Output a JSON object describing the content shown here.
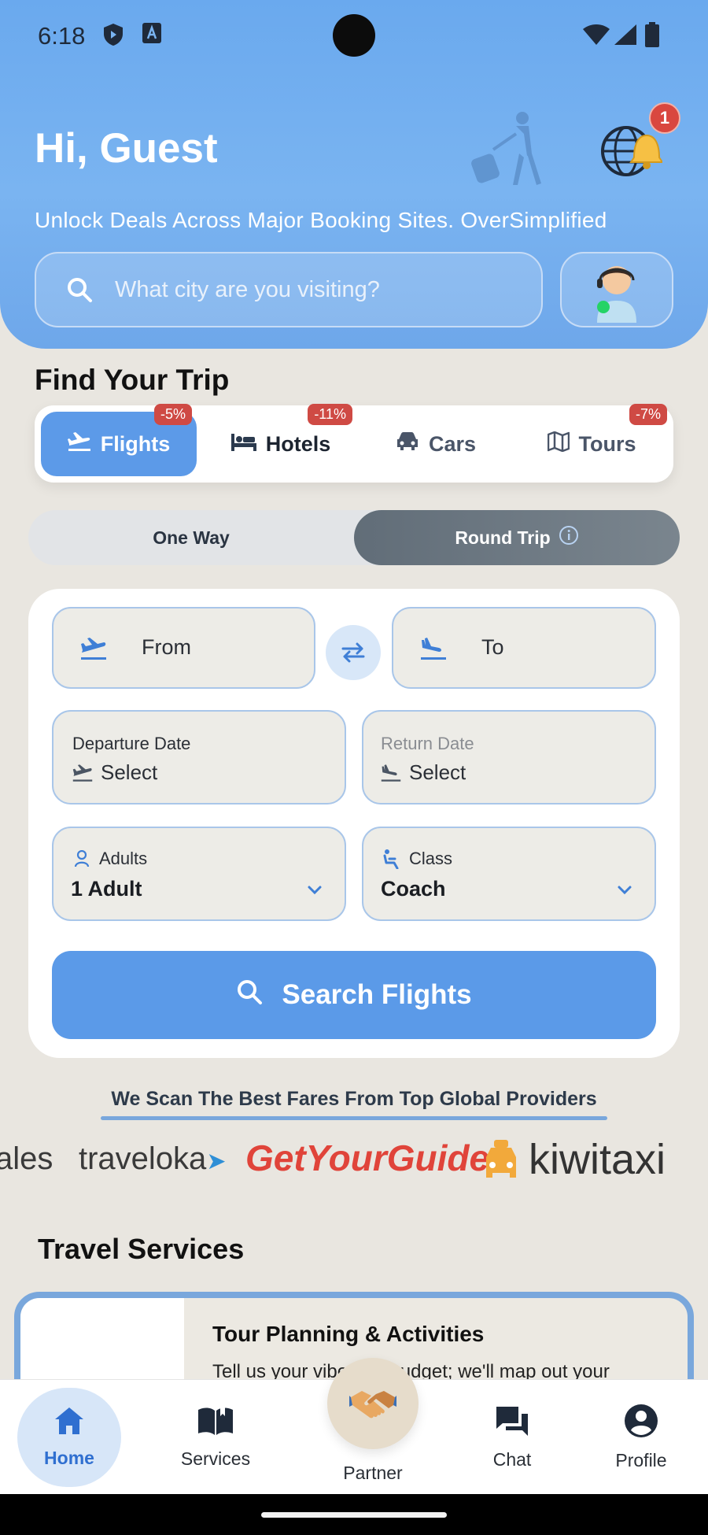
{
  "status_bar": {
    "time": "6:18",
    "icons": [
      "shield-icon",
      "a-box-icon",
      "wifi-icon",
      "signal-icon",
      "battery-icon"
    ]
  },
  "header": {
    "greeting": "Hi, Guest",
    "tagline": "Unlock Deals Across Major Booking Sites. OverSimplified",
    "notification_count": "1",
    "search_placeholder": "What city are you visiting?"
  },
  "find_trip": {
    "title": "Find Your Trip",
    "tabs": [
      {
        "label": "Flights",
        "discount": "-5%",
        "icon": "plane-icon",
        "active": true
      },
      {
        "label": "Hotels",
        "discount": "-11%",
        "icon": "bed-icon",
        "active": false
      },
      {
        "label": "Cars",
        "discount": "",
        "icon": "car-icon",
        "active": false
      },
      {
        "label": "Tours",
        "discount": "-7%",
        "icon": "map-icon",
        "active": false
      }
    ],
    "trip_types": [
      {
        "label": "One Way",
        "active": false
      },
      {
        "label": "Round Trip",
        "active": true
      }
    ]
  },
  "form": {
    "from_label": "From",
    "to_label": "To",
    "departure_label": "Departure Date",
    "departure_value": "Select",
    "return_label": "Return Date",
    "return_value": "Select",
    "adults_label": "Adults",
    "adults_value": "1 Adult",
    "class_label": "Class",
    "class_value": "Coach",
    "search_button": "Search Flights"
  },
  "providers": {
    "title": "We Scan The Best Fares From Top Global Providers",
    "logos": [
      "ales",
      "traveloka",
      "GetYourGuide",
      "kiwitaxi"
    ]
  },
  "travel_services": {
    "title": "Travel Services",
    "card_title": "Tour Planning & Activities",
    "card_desc": "Tell us your vibe and budget; we'll map out your"
  },
  "bottom_nav": {
    "items": [
      {
        "label": "Home",
        "icon": "home-icon",
        "active": true
      },
      {
        "label": "Services",
        "icon": "book-icon",
        "active": false
      },
      {
        "label": "Partner",
        "icon": "handshake-icon",
        "active": false
      },
      {
        "label": "Chat",
        "icon": "chat-icon",
        "active": false
      },
      {
        "label": "Profile",
        "icon": "profile-icon",
        "active": false
      }
    ]
  },
  "colors": {
    "primary": "#5b9ae8",
    "header": "#6aa9ee",
    "badge": "#d9473f",
    "discount": "#cf4a44",
    "getyourguide": "#e0443a",
    "kiwitaxi_yellow": "#f2a93b"
  }
}
